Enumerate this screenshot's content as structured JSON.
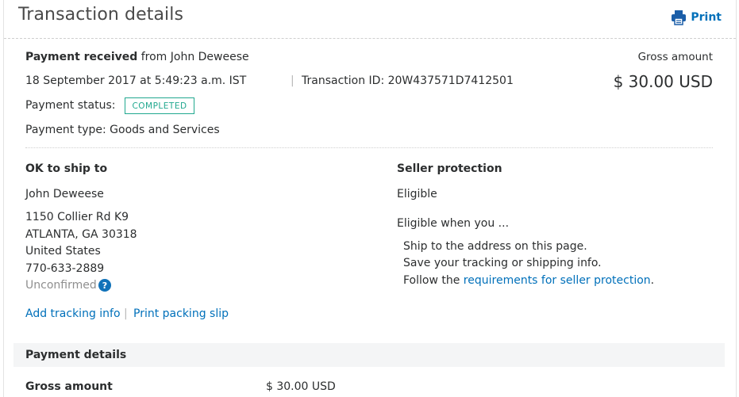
{
  "header": {
    "title": "Transaction details",
    "print_label": "Print",
    "print_icon": "printer-icon"
  },
  "summary": {
    "payment_received_label": "Payment received",
    "from_text": "from John Deweese",
    "datetime": "18 September 2017 at 5:49:23 a.m. IST",
    "separator": "|",
    "transaction_id_text": "Transaction ID: 20W437571D7412501",
    "status_label": "Payment status:",
    "status_badge": "COMPLETED",
    "payment_type": "Payment type: Goods and Services",
    "gross_amount_label": "Gross amount",
    "gross_amount_value": "$ 30.00 USD"
  },
  "shipping": {
    "heading": "OK to ship to",
    "name": "John Deweese",
    "address_line1": "1150 Collier Rd K9",
    "address_line2": "ATLANTA, GA 30318",
    "country": "United States",
    "phone": "770-633-2889",
    "address_status": "Unconfirmed",
    "help_icon_glyph": "?",
    "add_tracking_link": "Add tracking info",
    "links_separator": "|",
    "print_slip_link": "Print packing slip"
  },
  "seller_protection": {
    "heading": "Seller protection",
    "status": "Eligible",
    "intro": "Eligible when you ...",
    "items": [
      "Ship to the address on this page.",
      "Save your tracking or shipping info."
    ],
    "last_item_prefix": "Follow the ",
    "last_item_link": "requirements for seller protection",
    "last_item_suffix": "."
  },
  "payment_details": {
    "heading": "Payment details",
    "gross_amount_label": "Gross amount",
    "gross_amount_value": "$ 30.00 USD"
  },
  "colors": {
    "link": "#0070ba",
    "status_completed": "#21a88f",
    "help_icon_bg": "#1072b9",
    "section_bg": "#f4f5f6"
  }
}
